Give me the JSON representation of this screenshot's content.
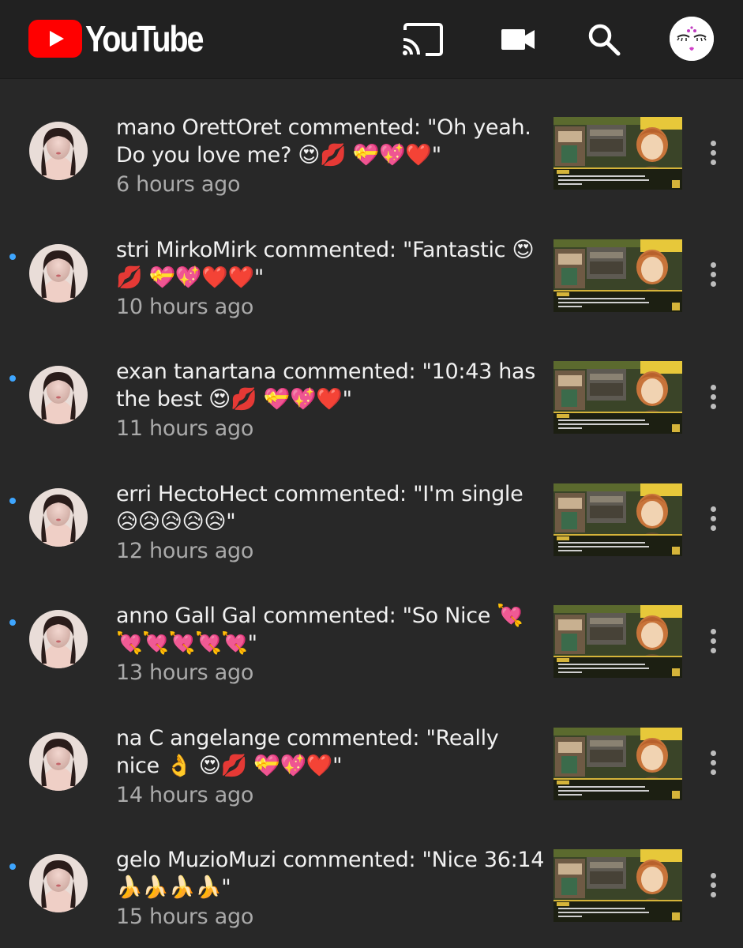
{
  "header": {
    "logo_text": "YouTube",
    "icons": [
      "cast-icon",
      "camera-icon",
      "search-icon",
      "account-avatar"
    ]
  },
  "colors": {
    "background": "#282828",
    "header": "#212121",
    "brand_red": "#ff0000",
    "unread_dot": "#3ea6ff",
    "secondary_text": "#aaaaaa"
  },
  "notifications": [
    {
      "unread": false,
      "text": "mano OrettOret commented: \"Oh yeah. Do you love me? 😍💋 💝💖❤️\"",
      "time": "6 hours ago"
    },
    {
      "unread": true,
      "text": "stri MirkoMirk commented: \"Fantastic 😍💋 💝💖❤️❤️\"",
      "time": "10 hours ago"
    },
    {
      "unread": true,
      "text": "exan tanartana commented: \"10:43 has the best 😍💋 💝💖❤️\"",
      "time": "11 hours ago"
    },
    {
      "unread": true,
      "text": "erri HectoHect commented: \"I'm single 😥😥😥😥😥\"",
      "time": "12 hours ago"
    },
    {
      "unread": true,
      "text": "anno Gall Gal commented: \"So Nice 💘💘💘💘💘💘\"",
      "time": "13 hours ago"
    },
    {
      "unread": false,
      "text": "na C angelange commented: \"Really nice 👌 😍💋 💝💖❤️\"",
      "time": "14 hours ago"
    },
    {
      "unread": true,
      "text": "gelo MuzioMuzi commented: \"Nice 36:14 🍌🍌🍌🍌\"",
      "time": "15 hours ago"
    }
  ]
}
